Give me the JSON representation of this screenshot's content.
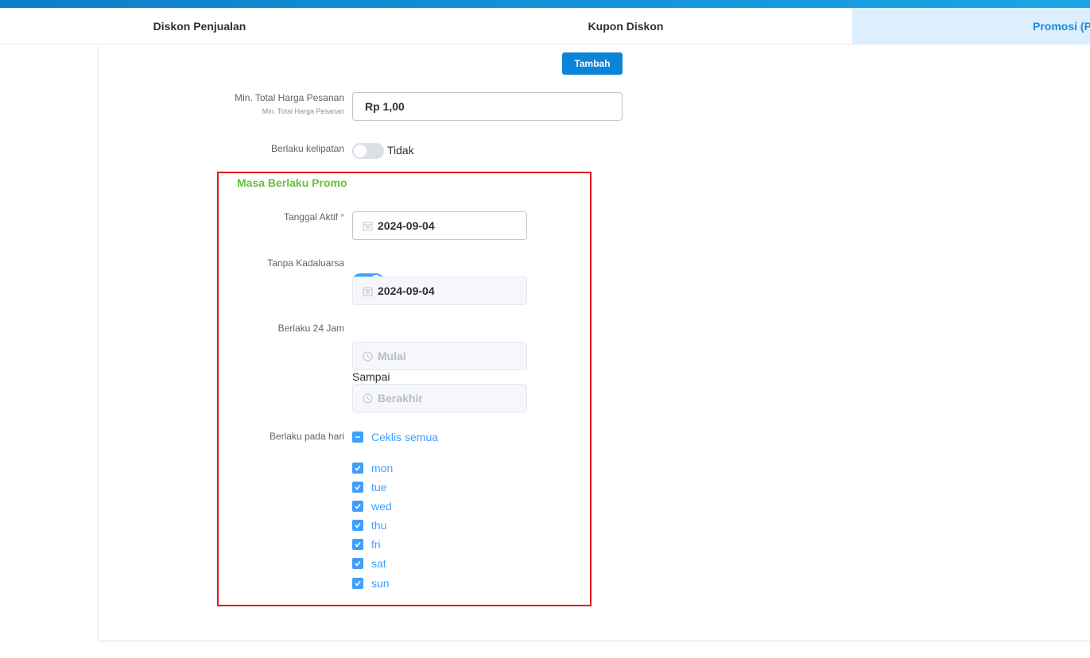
{
  "tabs": [
    {
      "label": "Diskon Penjualan"
    },
    {
      "label": "Kupon Diskon"
    },
    {
      "label": "Promosi (P("
    }
  ],
  "toolbar": {
    "add_label": "Tambah"
  },
  "min_total": {
    "label": "Min. Total Harga Pesanan",
    "sublabel": "Min. Total Harga Pesanan",
    "value": "Rp 1,00"
  },
  "multiple": {
    "label": "Berlaku kelipatan",
    "state_text": "Tidak",
    "on": false
  },
  "validity": {
    "title": "Masa Berlaku Promo",
    "start_date": {
      "label": "Tanggal Aktif",
      "required_mark": "*",
      "value": "2024-09-04"
    },
    "no_expiry": {
      "label": "Tanpa Kadaluarsa",
      "on": true,
      "end_date_value": "2024-09-04"
    },
    "all_day": {
      "label": "Berlaku 24 Jam",
      "on": true,
      "start_placeholder": "Mulai",
      "until_text": "Sampai",
      "end_placeholder": "Berakhir"
    },
    "days": {
      "label": "Berlaku pada hari",
      "check_all_label": "Ceklis semua",
      "items": [
        {
          "label": "mon",
          "checked": true
        },
        {
          "label": "tue",
          "checked": true
        },
        {
          "label": "wed",
          "checked": true
        },
        {
          "label": "thu",
          "checked": true
        },
        {
          "label": "fri",
          "checked": true
        },
        {
          "label": "sat",
          "checked": true
        },
        {
          "label": "sun",
          "checked": true
        }
      ]
    }
  },
  "colors": {
    "primary": "#409eff",
    "button": "#0a84d6",
    "section_title": "#67c23a",
    "highlight_box": "#e0191f"
  },
  "icons": {
    "date": "calendar-icon",
    "time": "clock-icon",
    "check": "check-icon",
    "indeterminate": "minus-icon"
  }
}
